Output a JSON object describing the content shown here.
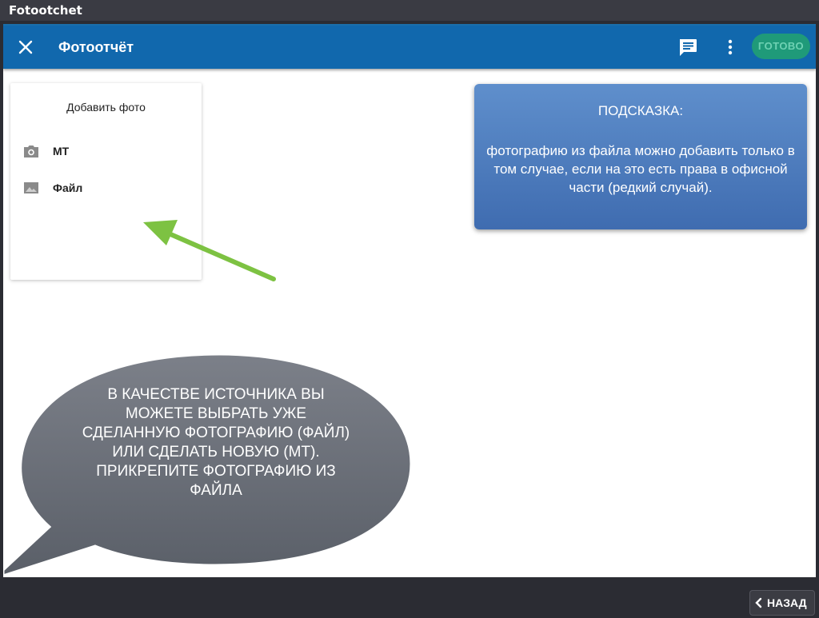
{
  "window": {
    "title": "Fotootchet"
  },
  "appbar": {
    "title": "Фотоотчёт",
    "done_label": "ГОТОВО"
  },
  "add_photo": {
    "title": "Добавить фото",
    "items": [
      {
        "label": "МТ",
        "icon": "camera-icon"
      },
      {
        "label": "Файл",
        "icon": "image-icon"
      }
    ]
  },
  "hint": {
    "title": "ПОДСКАЗКА:",
    "text": "фотографию из файла можно добавить только в том случае, если на это есть права в офисной части (редкий случай)."
  },
  "callout": {
    "lines": [
      "В КАЧЕСТВЕ ИСТОЧНИКА ВЫ",
      "МОЖЕТЕ ВЫБРАТЬ УЖЕ",
      "СДЕЛАННУЮ ФОТОГРАФИЮ (ФАЙЛ)",
      "ИЛИ СДЕЛАТЬ НОВУЮ (МТ).",
      "ПРИКРЕПИТЕ ФОТОГРАФИЮ ИЗ",
      "ФАЙЛА"
    ]
  },
  "nav": {
    "back_label": "НАЗАД"
  },
  "colors": {
    "appbar": "#1168ad",
    "done": "#1f9a79",
    "hint": "#4f7dc0",
    "callout": "#6b7079",
    "arrow": "#7dc242"
  }
}
